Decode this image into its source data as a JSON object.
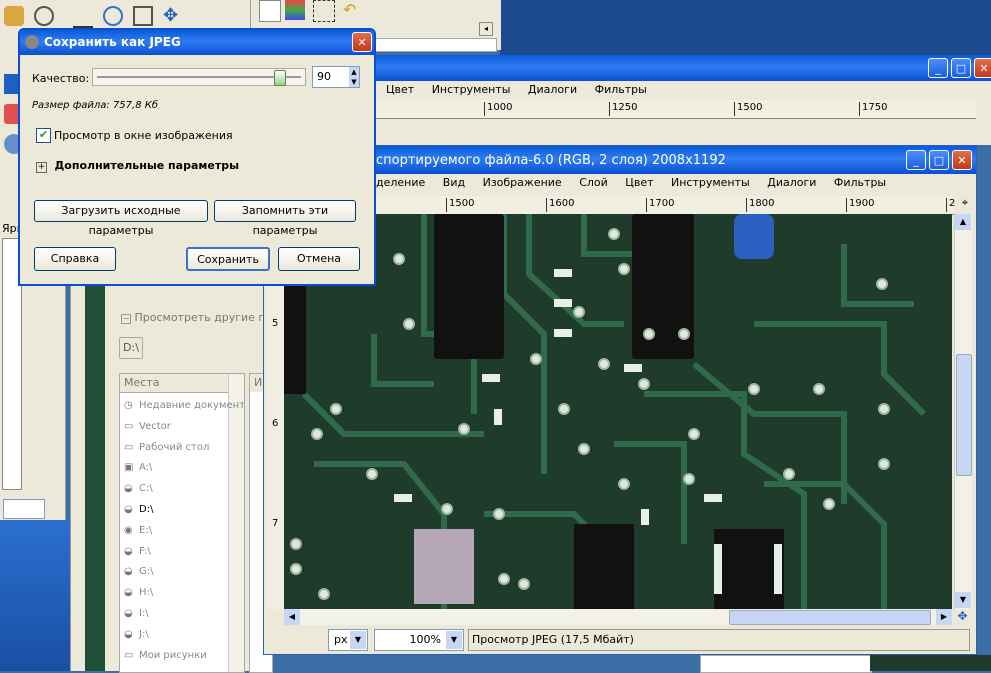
{
  "gimp_back_window": {
    "menu": [
      "Цвет",
      "Инструменты",
      "Диалоги",
      "Фильтры"
    ],
    "ruler": [
      "1000",
      "1250",
      "1500",
      "1750"
    ]
  },
  "image_window": {
    "title": "спортируемого файла-6.0 (RGB, 2 слоя) 2008x1192",
    "menu": [
      "деление",
      "Вид",
      "Изображение",
      "Слой",
      "Цвет",
      "Инструменты",
      "Диалоги",
      "Фильтры"
    ],
    "ruler": [
      "1500",
      "1600",
      "1700",
      "1800",
      "1900",
      "2"
    ],
    "vruler": [
      "5",
      "6",
      "7"
    ],
    "status": {
      "unit": "px",
      "zoom": "100%",
      "message": "Просмотр JPEG (17,5 Мбайт)"
    }
  },
  "file_chooser": {
    "browse_other": "Просмотреть другие папки",
    "path_button": "D:\\",
    "places_header": "Места",
    "name_header": "И",
    "places": [
      "Недавние документы",
      "Vector",
      "Рабочий стол",
      "A:\\",
      "C:\\",
      "D:\\",
      "E:\\",
      "F:\\",
      "G:\\",
      "H:\\",
      "I:\\",
      "J:\\",
      "Мои рисунки"
    ]
  },
  "layers_label": "Ярк",
  "jpeg_dialog": {
    "title": "Сохранить как JPEG",
    "quality_label": "Качество:",
    "quality_value": "90",
    "quality_fraction": 0.9,
    "file_size": "Размер файла: 757,8 Кб",
    "preview_label": "Просмотр в окне изображения",
    "preview_checked": true,
    "advanced_label": "Дополнительные параметры",
    "load_defaults": "Загрузить исходные параметры",
    "save_defaults": "Запомнить эти параметры",
    "help": "Справка",
    "save": "Сохранить",
    "cancel": "Отмена"
  },
  "colors": {
    "xp_blue": "#0a5bd8",
    "pcb_green": "#1e3b2c",
    "trace_green": "#2f6a4a"
  }
}
